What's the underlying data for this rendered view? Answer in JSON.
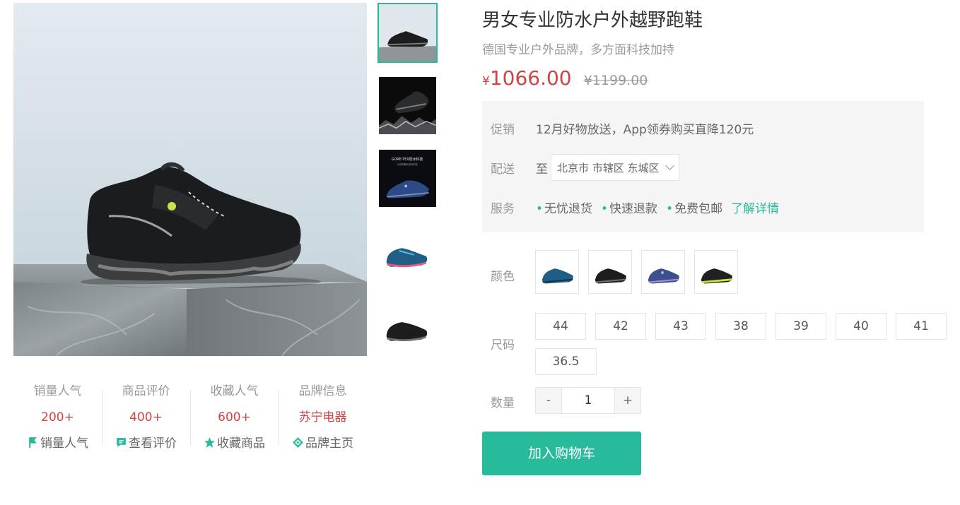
{
  "product": {
    "name": "男女专业防水户外越野跑鞋",
    "desc": "德国专业户外品牌，多方面科技加持",
    "currency": "¥",
    "price": "1066.00",
    "old_price": "¥1199.00"
  },
  "thumbnails": [
    {
      "icon": "shoe-on-pedestal-thumbnail"
    },
    {
      "icon": "shoe-on-rocks-thumbnail"
    },
    {
      "icon": "gore-tex-promo-thumbnail",
      "headline": "GORE-TEX防水科技",
      "sub": "为你的脚步保驾护航"
    },
    {
      "icon": "blue-shoe-thumbnail"
    },
    {
      "icon": "black-shoe-thumbnail"
    }
  ],
  "stats": [
    {
      "title": "销量人气",
      "value": "200+",
      "link": "销量人气",
      "icon": "flag-icon"
    },
    {
      "title": "商品评价",
      "value": "400+",
      "link": "查看评价",
      "icon": "comment-icon"
    },
    {
      "title": "收藏人气",
      "value": "600+",
      "link": "收藏商品",
      "icon": "star-icon"
    },
    {
      "title": "品牌信息",
      "value": "苏宁电器",
      "link": "品牌主页",
      "icon": "brand-icon"
    }
  ],
  "panel": {
    "promo_label": "促销",
    "promo_text": "12月好物放送，App领券购买直降120元",
    "delivery_label": "配送",
    "delivery_prefix": "至",
    "delivery_address": "北京市 市辖区 东城区",
    "service_label": "服务",
    "services": [
      "无忧退货",
      "快速退款",
      "免费包邮"
    ],
    "service_more": "了解详情"
  },
  "spec": {
    "color_label": "颜色",
    "colors": [
      "blue",
      "black",
      "purple-blue",
      "black-lime"
    ],
    "size_label": "尺码",
    "sizes": [
      "44",
      "42",
      "43",
      "38",
      "39",
      "40",
      "41",
      "36.5"
    ],
    "qty_label": "数量",
    "qty_minus": "-",
    "qty_value": "1",
    "qty_plus": "+"
  },
  "cart_button": "加入购物车",
  "colors": {
    "accent": "#27ba9b",
    "price": "#cf4444"
  }
}
